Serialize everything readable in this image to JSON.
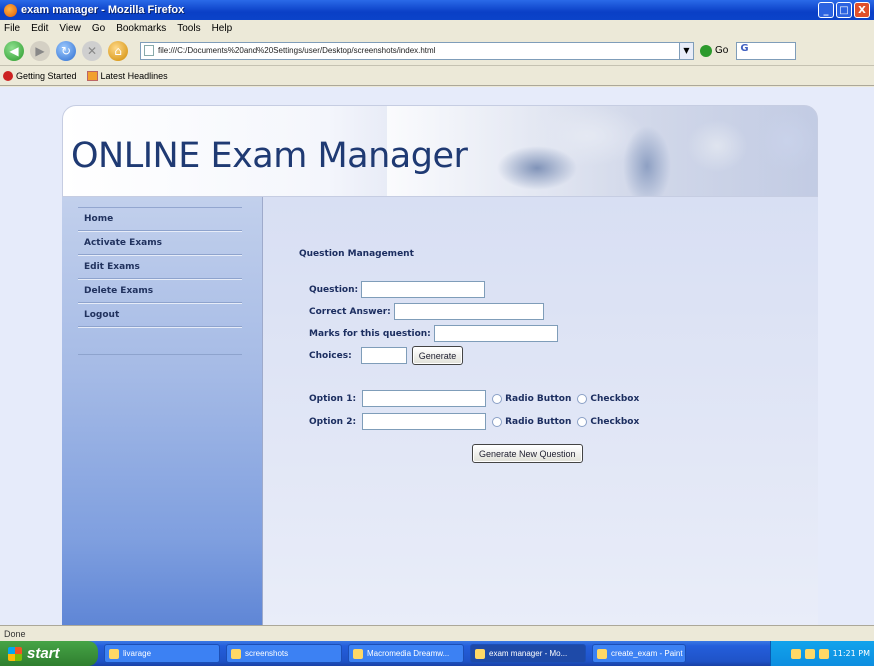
{
  "window": {
    "title": "exam manager - Mozilla Firefox",
    "buttons": [
      "_",
      "□",
      "X"
    ]
  },
  "menu": [
    "File",
    "Edit",
    "View",
    "Go",
    "Bookmarks",
    "Tools",
    "Help"
  ],
  "toolbar": {
    "url": "file:///C:/Documents%20and%20Settings/user/Desktop/screenshots/index.html",
    "go_label": "Go",
    "search_label": "G"
  },
  "bookmarks": [
    "Getting Started",
    "Latest Headlines"
  ],
  "page": {
    "logo": "ONLINE Exam Manager",
    "sidebar": [
      {
        "label": "Home"
      },
      {
        "label": "Activate Exams"
      },
      {
        "label": "Edit Exams"
      },
      {
        "label": "Delete Exams"
      },
      {
        "label": "Logout"
      }
    ],
    "form": {
      "heading": "Question Management",
      "question_label": "Question:",
      "answer_label": "Correct Answer:",
      "marks_label": "Marks for this question:",
      "choices_label": "Choices:",
      "generate_label": "Generate",
      "options": [
        {
          "label": "Option 1:",
          "radio_label": "Radio Button",
          "checkbox_label": "Checkbox"
        },
        {
          "label": "Option 2:",
          "radio_label": "Radio Button",
          "checkbox_label": "Checkbox"
        }
      ],
      "generate_new_label": "Generate New Question"
    }
  },
  "status": "Done",
  "taskbar": {
    "start_label": "start",
    "tasks": [
      {
        "label": "livarage"
      },
      {
        "label": "screenshots"
      },
      {
        "label": "Macromedia Dreamw..."
      },
      {
        "label": "exam manager - Mo..."
      },
      {
        "label": "create_exam - Paint"
      }
    ],
    "clock": "11:21 PM"
  }
}
